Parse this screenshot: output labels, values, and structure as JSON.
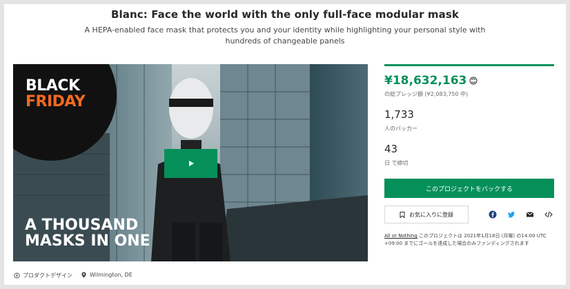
{
  "project": {
    "title": "Blanc: Face the world with the only full-face modular mask",
    "subtitle": "A HEPA-enabled face mask that protects you and your identity while highlighting your personal style with hundreds of changeable panels"
  },
  "video": {
    "badge_line1": "BLACK",
    "badge_line2": "FRIDAY",
    "overlay_line1": "A THOUSAND",
    "overlay_line2": "MASKS IN ONE",
    "play_icon": "play-icon"
  },
  "meta": {
    "category": "プロダクトデザイン",
    "location": "Wilmington, DE"
  },
  "stats": {
    "pledged": "¥18,632,163",
    "pledged_sub": "の総プレッジ額 (¥2,083,750 中)",
    "backers": "1,733",
    "backers_sub": "人のバッカー",
    "days": "43",
    "days_sub": "日 で締切"
  },
  "actions": {
    "back_label": "このプロジェクトをバックする",
    "favorite_label": "お気に入りに登録",
    "share_icons": [
      "facebook-icon",
      "twitter-icon",
      "email-icon",
      "embed-icon"
    ]
  },
  "notice": {
    "link": "All or Nothing",
    "text": " このプロジェクトは 2021年1月18日 (月曜) の14:00 UTC +09:00 までにゴールを達成した場合のみファンディングされます"
  },
  "colors": {
    "accent": "#05905a",
    "badge_orange": "#f26a21"
  }
}
